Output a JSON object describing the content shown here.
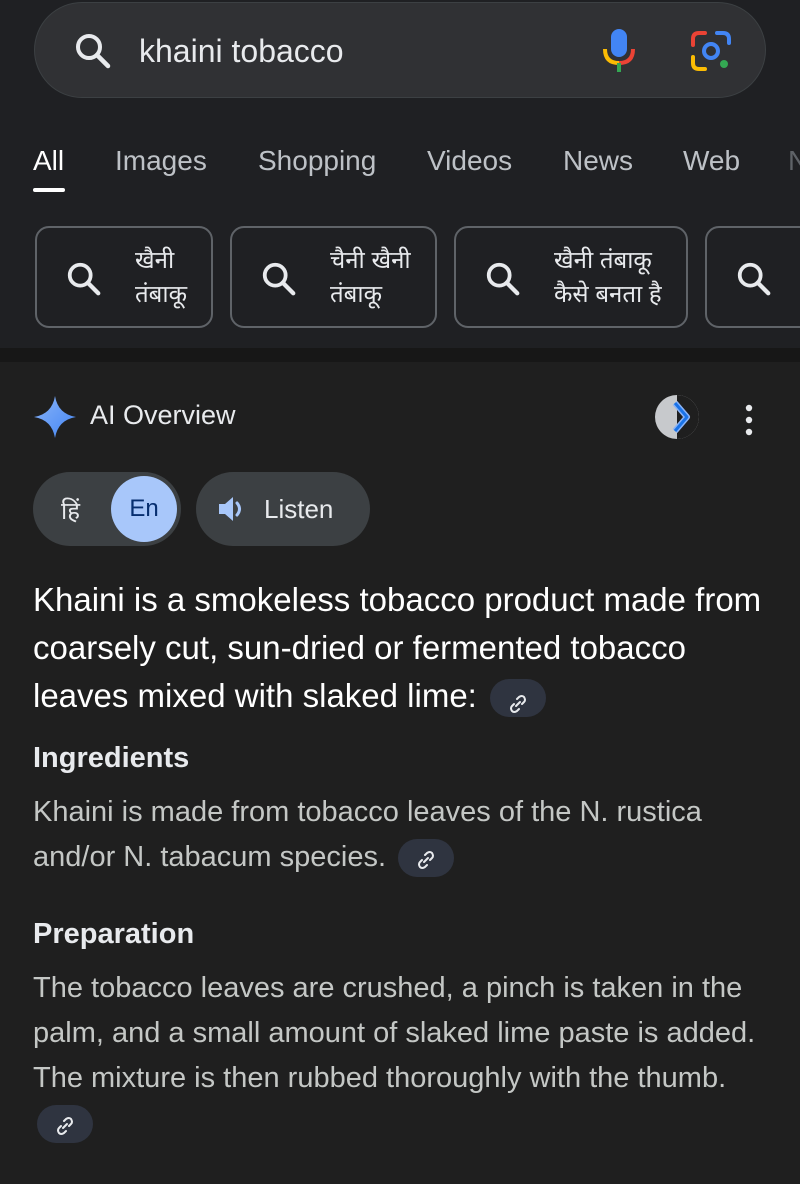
{
  "search": {
    "query": "khaini tobacco"
  },
  "tabs": [
    {
      "label": "All"
    },
    {
      "label": "Images"
    },
    {
      "label": "Shopping"
    },
    {
      "label": "Videos"
    },
    {
      "label": "News"
    },
    {
      "label": "Web"
    },
    {
      "label": "N"
    }
  ],
  "chips": [
    {
      "text": "खैनी\nतंबाकू"
    },
    {
      "text": "चैनी खैनी\nतंबाकू"
    },
    {
      "text": "खैनी तंबाकू\nकैसे बनता है"
    }
  ],
  "ai_overview": {
    "title": "AI Overview",
    "lang_hi": "हिं",
    "lang_en": "En",
    "listen_label": "Listen",
    "lead": "Khaini is a smokeless tobacco product made from coarsely cut, sun-dried or fermented tobacco leaves mixed with slaked lime:",
    "sections": [
      {
        "heading": "Ingredients",
        "body": "Khaini is made from tobacco leaves of the N. rustica and/or N. tabacum species."
      },
      {
        "heading": "Preparation",
        "body": "The tobacco leaves are crushed, a pinch is taken in the palm, and a small amount of slaked lime paste is added. The mixture is then rubbed thoroughly with the thumb."
      }
    ]
  },
  "colors": {
    "accent": "#a8c7fa",
    "background": "#1f1f1f",
    "chip_border": "#5f6368"
  },
  "icons": [
    "search-icon",
    "mic-icon",
    "lens-icon",
    "sparkle-icon",
    "more-vert-icon",
    "speaker-icon",
    "link-icon"
  ]
}
